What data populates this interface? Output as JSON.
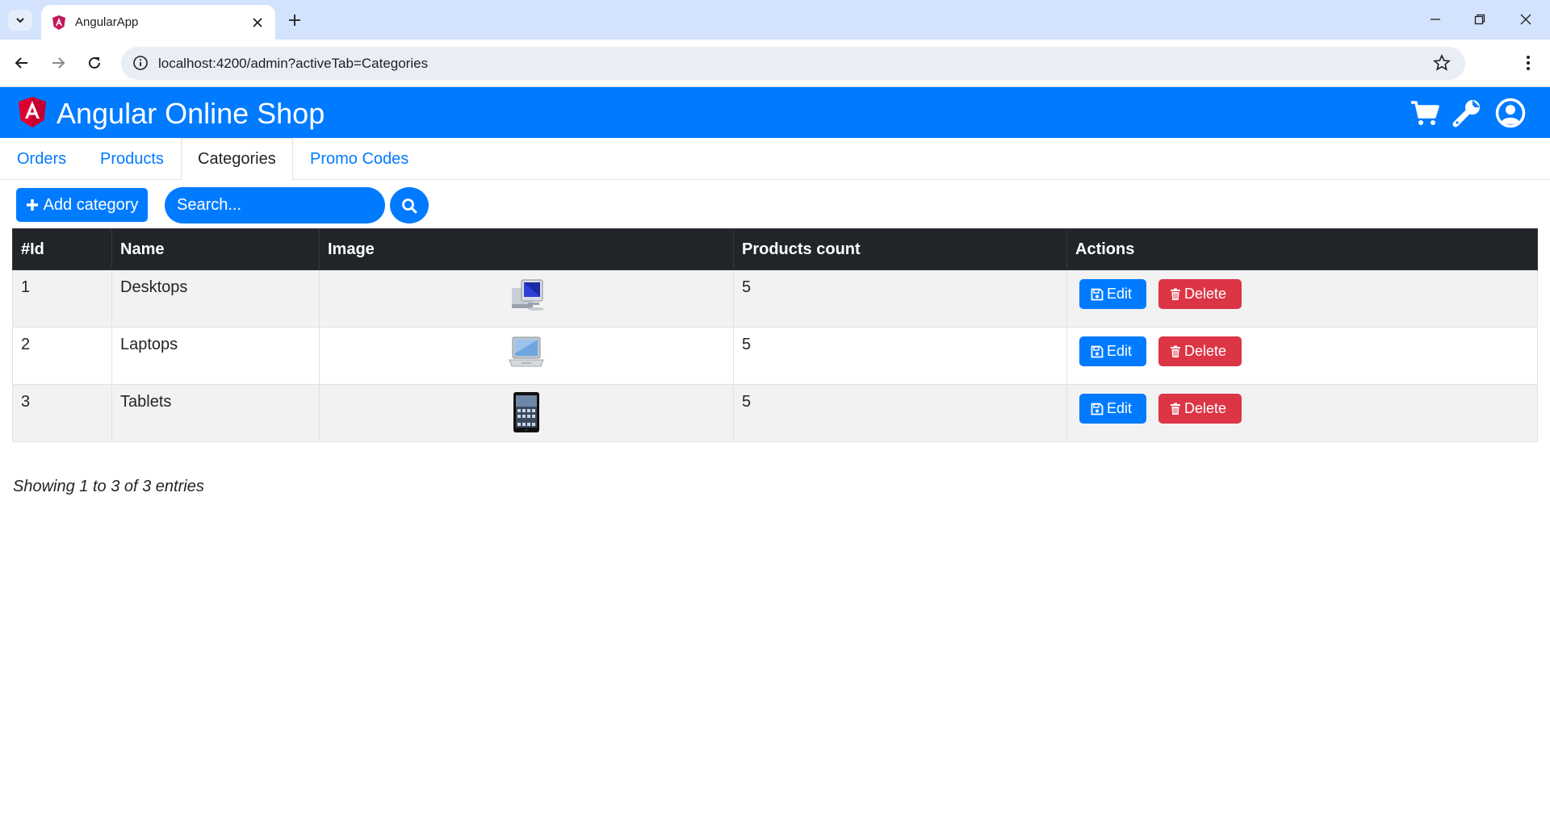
{
  "browser": {
    "tab_title": "AngularApp",
    "url": "localhost:4200/admin?activeTab=Categories"
  },
  "header": {
    "brand": "Angular Online Shop",
    "icons": [
      "cart-icon",
      "wrench-icon",
      "user-circle-icon"
    ]
  },
  "tabs": [
    {
      "label": "Orders",
      "active": false
    },
    {
      "label": "Products",
      "active": false
    },
    {
      "label": "Categories",
      "active": true
    },
    {
      "label": "Promo Codes",
      "active": false
    }
  ],
  "controls": {
    "add_label": "Add category",
    "search_placeholder": "Search..."
  },
  "table": {
    "headers": [
      "#Id",
      "Name",
      "Image",
      "Products count",
      "Actions"
    ],
    "rows": [
      {
        "id": "1",
        "name": "Desktops",
        "image": "desktop-image",
        "count": "5"
      },
      {
        "id": "2",
        "name": "Laptops",
        "image": "laptop-image",
        "count": "5"
      },
      {
        "id": "3",
        "name": "Tablets",
        "image": "tablet-image",
        "count": "5"
      }
    ],
    "edit_label": "Edit",
    "delete_label": "Delete"
  },
  "footer": {
    "info": "Showing 1 to 3 of 3 entries"
  },
  "colors": {
    "primary": "#007bff",
    "danger": "#dc3545",
    "dark": "#212529",
    "chrome_tabstrip": "#d3e3fd"
  }
}
